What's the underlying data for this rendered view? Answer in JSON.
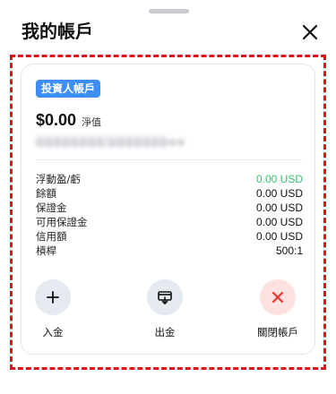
{
  "header": {
    "title": "我的帳戶",
    "close_icon": "close-icon"
  },
  "account": {
    "badge": "投資人帳戶",
    "balance": "$0.00",
    "balance_label": "淨值",
    "redacted_id": "●●●●●●●● ●●●●●●●●●"
  },
  "details": [
    {
      "label": "浮動盈/虧",
      "value": "0.00 USD",
      "status_color": "#31c46b"
    },
    {
      "label": "餘額",
      "value": "0.00 USD"
    },
    {
      "label": "保證金",
      "value": "0.00 USD"
    },
    {
      "label": "可用保證金",
      "value": "0.00 USD"
    },
    {
      "label": "信用額",
      "value": "0.00 USD"
    },
    {
      "label": "槓桿",
      "value": "500:1"
    }
  ],
  "actions": {
    "deposit": {
      "label": "入金",
      "icon": "plus-icon"
    },
    "withdraw": {
      "label": "出金",
      "icon": "withdraw-icon"
    },
    "close_account": {
      "label": "關閉帳戶",
      "icon": "x-icon",
      "color": "#e53935"
    }
  },
  "colors": {
    "badge": "#3d8ef7",
    "highlight_frame": "#e0131b",
    "positive": "#31c46b"
  }
}
